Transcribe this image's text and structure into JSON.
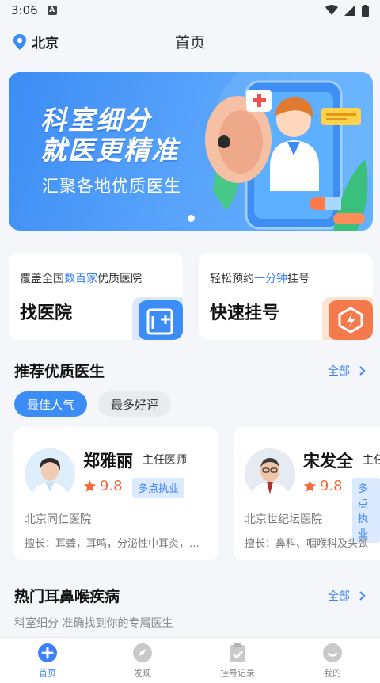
{
  "status": {
    "time": "3:06",
    "notif": "A"
  },
  "header": {
    "location": "北京",
    "title": "首页"
  },
  "banner": {
    "line1": "科室细分",
    "line2": "就医更精准",
    "subtitle": "汇聚各地优质医生"
  },
  "quick": [
    {
      "desc_pre": "覆盖全国",
      "desc_hl": "数百家",
      "desc_post": "优质医院",
      "title": "找医院",
      "icon": "hospital-icon"
    },
    {
      "desc_pre": "轻松预约",
      "desc_hl": "一分钟",
      "desc_post": "挂号",
      "title": "快速挂号",
      "icon": "lightning-icon"
    }
  ],
  "recommend": {
    "title": "推荐优质医生",
    "more": "全部",
    "chips": [
      "最佳人气",
      "最多好评"
    ],
    "doctors": [
      {
        "name": "郑雅丽",
        "title": "主任医师",
        "rating": "9.8",
        "badge": "多点执业",
        "hospital": "北京同仁医院",
        "specialty": "擅长：耳聋，耳鸣，分泌性中耳炎，鼓膜穿孔"
      },
      {
        "name": "宋发全",
        "title": "主任医师",
        "rating": "9.8",
        "badge": "多点执业",
        "hospital": "北京世纪坛医院",
        "specialty": "擅长：鼻科、咽喉科及头颈"
      }
    ]
  },
  "diseases": {
    "title": "热门耳鼻喉疾病",
    "more": "全部",
    "subtitle": "科室细分 准确找到你的专属医生"
  },
  "tabbar": [
    {
      "label": "首页",
      "icon": "plus-circle-icon"
    },
    {
      "label": "发现",
      "icon": "compass-icon"
    },
    {
      "label": "挂号记录",
      "icon": "clipboard-icon"
    },
    {
      "label": "我的",
      "icon": "profile-icon"
    }
  ],
  "colors": {
    "accent": "#3b82f6",
    "rating": "#f26b3a",
    "banner": "#4a98f8"
  }
}
